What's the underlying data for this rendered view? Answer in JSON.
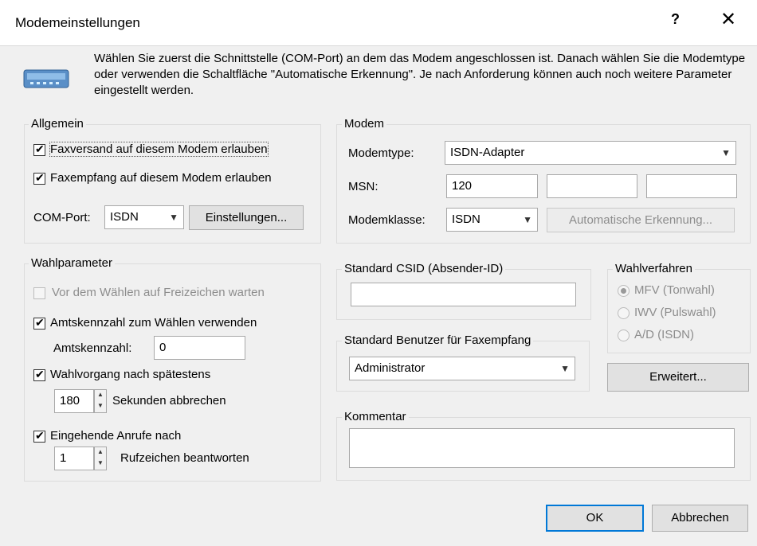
{
  "window": {
    "title": "Modemeinstellungen",
    "help_label": "?",
    "close_label": "✕"
  },
  "intro": "Wählen Sie zuerst die Schnittstelle (COM-Port) an dem das Modem angeschlossen ist. Danach wählen Sie die Modemtype oder verwenden die Schaltfläche \"Automatische Erkennung\". Je nach Anforderung können auch noch weitere Parameter eingestellt werden.",
  "allgemein": {
    "title": "Allgemein",
    "faxversand": "Faxversand auf diesem Modem erlauben",
    "faxempfang": "Faxempfang auf diesem Modem erlauben",
    "com_label": "COM-Port:",
    "com_value": "ISDN",
    "einstellungen": "Einstellungen..."
  },
  "modem": {
    "title": "Modem",
    "type_label": "Modemtype:",
    "type_value": "ISDN-Adapter",
    "msn_label": "MSN:",
    "msn1": "120",
    "msn2": "",
    "msn3": "",
    "klasse_label": "Modemklasse:",
    "klasse_value": "ISDN",
    "auto": "Automatische Erkennung..."
  },
  "wahl": {
    "title": "Wahlparameter",
    "freizeichen": "Vor dem Wählen auf Freizeichen warten",
    "amtskennzahl_use": "Amtskennzahl zum Wählen verwenden",
    "amtskennzahl_label": "Amtskennzahl:",
    "amtskennzahl_value": "0",
    "wahlvorgang": "Wahlvorgang nach spätestens",
    "sek_value": "180",
    "sek_label": "Sekunden abbrechen",
    "eingehend": "Eingehende Anrufe nach",
    "ruf_value": "1",
    "ruf_label": "Rufzeichen beantworten"
  },
  "csid": {
    "title": "Standard CSID (Absender-ID)",
    "value": ""
  },
  "benutzer": {
    "title": "Standard Benutzer für Faxempfang",
    "value": "Administrator"
  },
  "verfahren": {
    "title": "Wahlverfahren",
    "mfv": "MFV (Tonwahl)",
    "iwv": "IWV (Pulswahl)",
    "ad": "A/D (ISDN)"
  },
  "erweitert": "Erweitert...",
  "kommentar": {
    "title": "Kommentar",
    "value": ""
  },
  "footer": {
    "ok": "OK",
    "abbrechen": "Abbrechen"
  }
}
